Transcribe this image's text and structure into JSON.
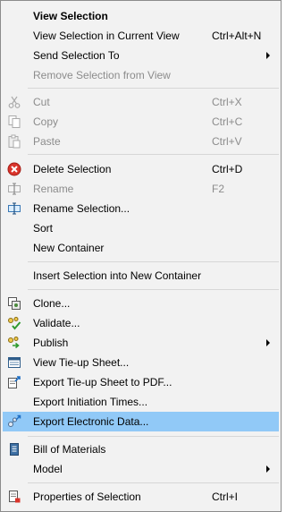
{
  "menu": {
    "view_selection": "View Selection",
    "view_in_current": "View Selection in Current View",
    "view_in_current_sc": "Ctrl+Alt+N",
    "send_to": "Send Selection To",
    "remove_from_view": "Remove Selection from View",
    "cut": "Cut",
    "cut_sc": "Ctrl+X",
    "copy": "Copy",
    "copy_sc": "Ctrl+C",
    "paste": "Paste",
    "paste_sc": "Ctrl+V",
    "delete": "Delete Selection",
    "delete_sc": "Ctrl+D",
    "rename": "Rename",
    "rename_sc": "F2",
    "rename_selection": "Rename Selection...",
    "sort": "Sort",
    "new_container": "New Container",
    "insert_new_container": "Insert Selection into New Container",
    "clone": "Clone...",
    "validate": "Validate...",
    "publish": "Publish",
    "view_tieup": "View Tie-up Sheet...",
    "export_tieup_pdf": "Export Tie-up Sheet to PDF...",
    "export_initiation": "Export Initiation Times...",
    "export_electronic": "Export Electronic Data...",
    "bom": "Bill of Materials",
    "model": "Model",
    "properties": "Properties of Selection",
    "properties_sc": "Ctrl+I"
  },
  "colors": {
    "menu_bg": "#f2f2f2",
    "highlight": "#91c9f7",
    "disabled_text": "#8c8c8c",
    "separator": "#d7d7d7"
  },
  "icons": {
    "cut": "scissors-icon",
    "copy": "copy-icon",
    "paste": "paste-icon",
    "delete": "red-x-circle-icon",
    "rename": "text-cursor-icon",
    "rename_selection": "text-cursor-icon",
    "clone": "clone-icon",
    "validate": "validate-icon",
    "publish": "publish-icon",
    "view_tieup": "sheet-icon",
    "export_tieup_pdf": "export-sheet-icon",
    "export_electronic": "export-data-icon",
    "bom": "document-icon",
    "properties": "properties-icon"
  }
}
